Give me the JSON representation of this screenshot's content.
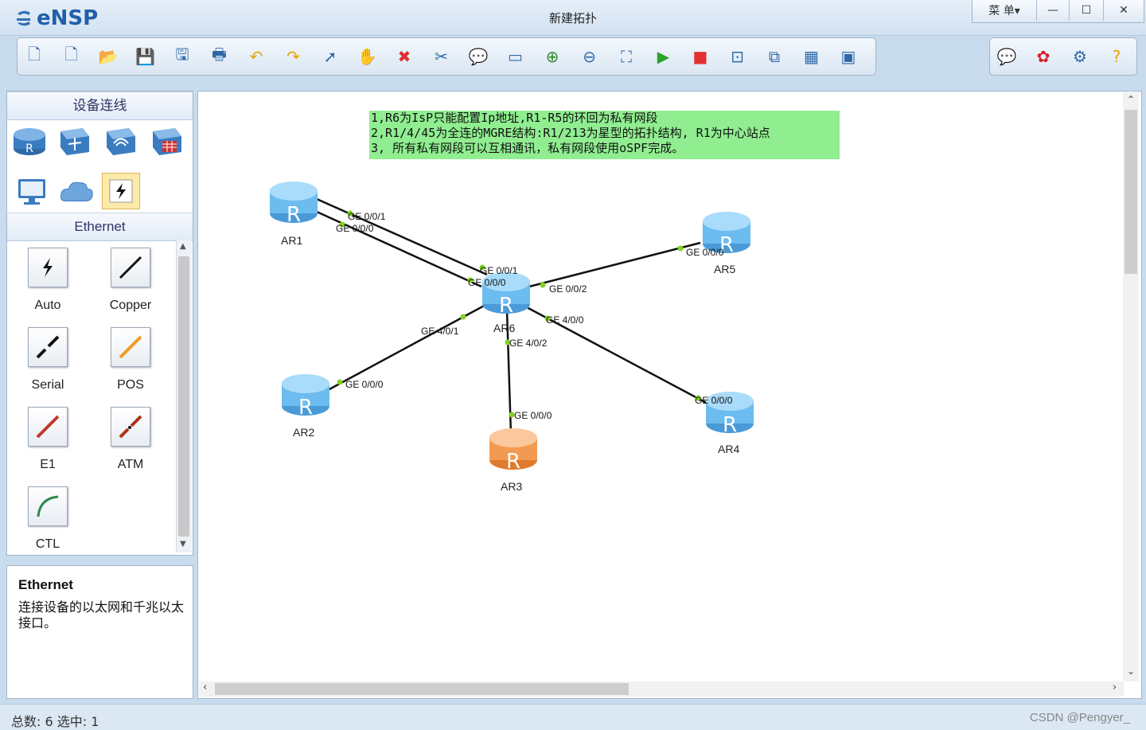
{
  "app": {
    "name": "eNSP",
    "window_title": "新建拓扑"
  },
  "window_buttons": {
    "menu": "菜 单▾",
    "minimize": "—",
    "maximize": "☐",
    "close": "✕"
  },
  "toolbar": {
    "left_icons": [
      "new-topology-icon",
      "new-example-icon",
      "open-icon",
      "save-icon",
      "save-as-icon",
      "print-icon",
      "undo-icon",
      "redo-icon",
      "select-pointer-icon",
      "pan-hand-icon",
      "delete-icon",
      "delete-link-icon",
      "text-note-icon",
      "palette-icon",
      "zoom-in-icon",
      "zoom-out-icon",
      "fit-view-icon",
      "start-device-icon",
      "stop-device-icon",
      "capture-icon",
      "topology-icon",
      "grid-icon",
      "terminal-icon"
    ],
    "right_icons": [
      "chat-icon",
      "huawei-icon",
      "settings-icon",
      "help-icon"
    ]
  },
  "left_panel": {
    "section_title": "设备连线",
    "device_icons": [
      "router-icon",
      "switch-icon",
      "wireless-icon",
      "firewall-icon",
      "pc-icon",
      "cloud-icon",
      "link-icon"
    ],
    "links_title": "Ethernet",
    "link_types": [
      {
        "label": "Auto",
        "icon": "auto-link-icon",
        "color": "#111111"
      },
      {
        "label": "Copper",
        "icon": "copper-link-icon",
        "color": "#111111"
      },
      {
        "label": "Serial",
        "icon": "serial-link-icon",
        "color": "#111111"
      },
      {
        "label": "POS",
        "icon": "pos-link-icon",
        "color": "#f39a1e"
      },
      {
        "label": "E1",
        "icon": "e1-link-icon",
        "color": "#c0392b"
      },
      {
        "label": "ATM",
        "icon": "atm-link-icon",
        "color": "#b03018"
      },
      {
        "label": "CTL",
        "icon": "ctl-link-icon",
        "color": "#2a8a4a"
      }
    ]
  },
  "description": {
    "title": "Ethernet",
    "text": "连接设备的以太网和千兆以太接口。"
  },
  "note": {
    "lines": [
      "1,R6为IsP只能配置Ip地址,R1-R5的环回为私有网段",
      "2,R1/4/45为全连的MGRE结构:R1/213为星型的拓扑结构, R1为中心站点",
      "3, 所有私有网段可以互相通讯，私有网段使用oSPF完成。"
    ],
    "color": "#90ee90"
  },
  "topology": {
    "routers": [
      {
        "name": "AR1",
        "color": "blue"
      },
      {
        "name": "AR5",
        "color": "blue"
      },
      {
        "name": "AR6",
        "color": "blue"
      },
      {
        "name": "AR2",
        "color": "blue"
      },
      {
        "name": "AR3",
        "color": "orange"
      },
      {
        "name": "AR4",
        "color": "blue"
      }
    ],
    "ports": [
      "GE 0/0/1",
      "GE 0/0/0",
      "GE 0/0/0",
      "GE 0/0/1",
      "GE 0/0/0",
      "GE 0/0/2",
      "GE 4/0/0",
      "GE 4/0/1",
      "GE 4/0/2",
      "GE 0/0/0",
      "GE 0/0/0",
      "GE 0/0/0"
    ]
  },
  "status": {
    "text": "总数:  6  选中:  1",
    "watermark": "CSDN @Pengyer_"
  }
}
